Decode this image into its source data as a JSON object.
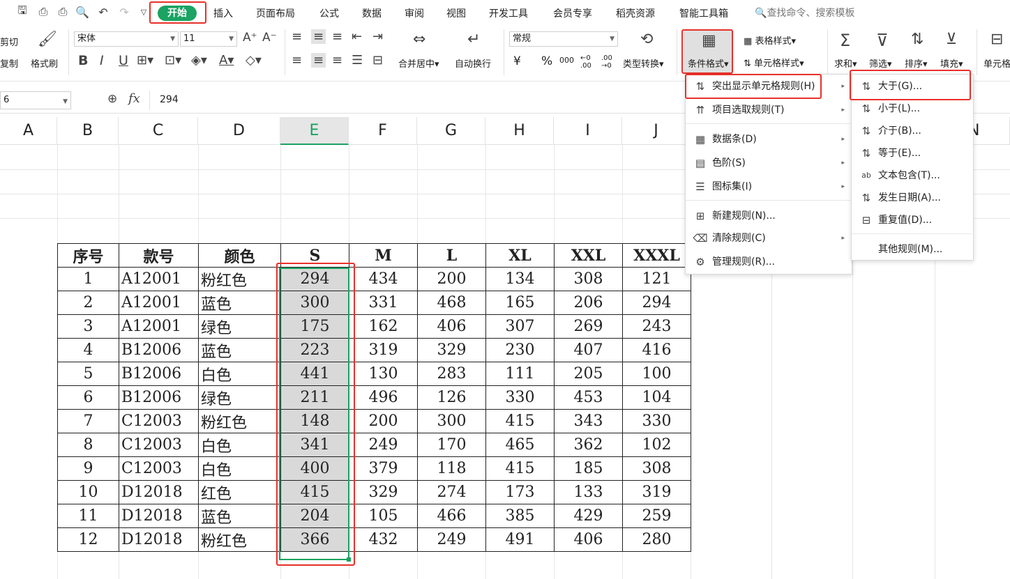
{
  "tabs": [
    "开始",
    "插入",
    "页面布局",
    "公式",
    "数据",
    "审阅",
    "视图",
    "开发工具",
    "会员专享",
    "稻壳资源",
    "智能工具箱"
  ],
  "search_placeholder": "查找命令、搜索模板",
  "ribbon": {
    "cut": "剪切",
    "copy": "复制",
    "format_painter": "格式刷",
    "font_name": "宋体",
    "font_size": "11",
    "merge_center": "合并居中",
    "wrap_text": "自动换行",
    "number_format": "常规",
    "type_convert": "类型转换",
    "conditional_format": "条件格式",
    "table_style": "表格样式",
    "cell_style": "单元格样式",
    "sum": "求和",
    "filter": "筛选",
    "sort": "排序",
    "fill": "填充",
    "cell": "单元格",
    "currency": "¥",
    "percent": "%",
    "thousands": "000",
    "inc_dec": "←0 .00",
    "dec_dec": ".00 →0"
  },
  "formula_bar": {
    "name_box": "6",
    "fx": "fx",
    "value": "294"
  },
  "columns": [
    "A",
    "B",
    "C",
    "D",
    "E",
    "F",
    "G",
    "H",
    "I",
    "J",
    "N"
  ],
  "table": {
    "headers": [
      "序号",
      "款号",
      "颜色",
      "S",
      "M",
      "L",
      "XL",
      "XXL",
      "XXXL"
    ],
    "rows": [
      [
        "1",
        "A12001",
        "粉红色",
        "294",
        "434",
        "200",
        "134",
        "308",
        "121"
      ],
      [
        "2",
        "A12001",
        "蓝色",
        "300",
        "331",
        "468",
        "165",
        "206",
        "294"
      ],
      [
        "3",
        "A12001",
        "绿色",
        "175",
        "162",
        "406",
        "307",
        "269",
        "243"
      ],
      [
        "4",
        "B12006",
        "蓝色",
        "223",
        "319",
        "329",
        "230",
        "407",
        "416"
      ],
      [
        "5",
        "B12006",
        "白色",
        "441",
        "130",
        "283",
        "111",
        "205",
        "100"
      ],
      [
        "6",
        "B12006",
        "绿色",
        "211",
        "496",
        "126",
        "330",
        "453",
        "104"
      ],
      [
        "7",
        "C12003",
        "粉红色",
        "148",
        "200",
        "300",
        "415",
        "343",
        "330"
      ],
      [
        "8",
        "C12003",
        "白色",
        "341",
        "249",
        "170",
        "465",
        "362",
        "102"
      ],
      [
        "9",
        "C12003",
        "白色",
        "400",
        "379",
        "118",
        "415",
        "185",
        "308"
      ],
      [
        "10",
        "D12018",
        "红色",
        "415",
        "329",
        "274",
        "173",
        "133",
        "319"
      ],
      [
        "11",
        "D12018",
        "蓝色",
        "204",
        "105",
        "466",
        "385",
        "429",
        "259"
      ],
      [
        "12",
        "D12018",
        "粉红色",
        "366",
        "432",
        "249",
        "491",
        "406",
        "280"
      ]
    ]
  },
  "cf_menu": [
    {
      "label": "突出显示单元格规则(H)",
      "icon": "highlight-rules-icon",
      "glyph": "⇅",
      "sub": true
    },
    {
      "label": "项目选取规则(T)",
      "icon": "top-bottom-rules-icon",
      "glyph": "⇈",
      "sub": true
    },
    {
      "label": "数据条(D)",
      "icon": "data-bars-icon",
      "glyph": "▦",
      "sub": true
    },
    {
      "label": "色阶(S)",
      "icon": "color-scales-icon",
      "glyph": "▤",
      "sub": true
    },
    {
      "label": "图标集(I)",
      "icon": "icon-sets-icon",
      "glyph": "☰",
      "sub": true
    },
    {
      "label": "新建规则(N)...",
      "icon": "new-rule-icon",
      "glyph": "⊞",
      "sub": false
    },
    {
      "label": "清除规则(C)",
      "icon": "clear-rules-icon",
      "glyph": "⌫",
      "sub": true
    },
    {
      "label": "管理规则(R)...",
      "icon": "manage-rules-icon",
      "glyph": "⚙",
      "sub": false
    }
  ],
  "highlight_submenu": [
    {
      "label": "大于(G)...",
      "icon": "greater-than-icon",
      "glyph": "⇅"
    },
    {
      "label": "小于(L)...",
      "icon": "less-than-icon",
      "glyph": "⇅"
    },
    {
      "label": "介于(B)...",
      "icon": "between-icon",
      "glyph": "⇅"
    },
    {
      "label": "等于(E)...",
      "icon": "equal-to-icon",
      "glyph": "⇅"
    },
    {
      "label": "文本包含(T)...",
      "icon": "text-contains-icon",
      "glyph": "ab"
    },
    {
      "label": "发生日期(A)...",
      "icon": "date-occurring-icon",
      "glyph": "⇅"
    },
    {
      "label": "重复值(D)...",
      "icon": "duplicate-values-icon",
      "glyph": "⊟"
    },
    {
      "label": "其他规则(M)...",
      "icon": "",
      "glyph": ""
    }
  ],
  "colors": {
    "accent": "#1aa362",
    "highlight_border": "#e8302a",
    "selection_fill": "#d9d9d9"
  }
}
